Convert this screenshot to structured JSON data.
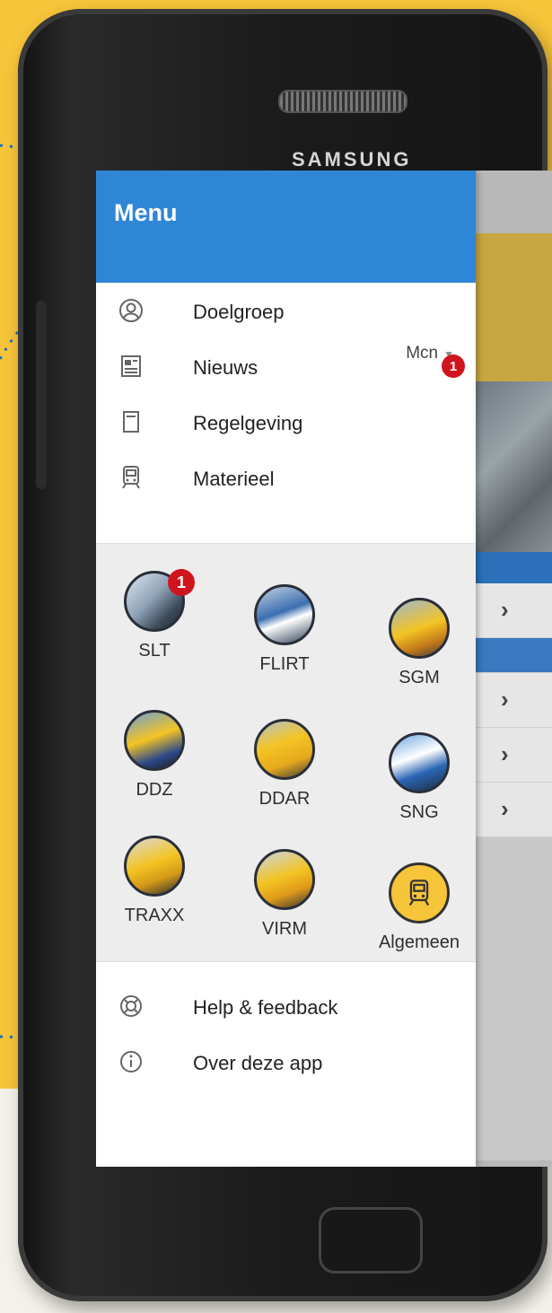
{
  "device": {
    "brand": "SAMSUNG"
  },
  "drawer": {
    "title": "Menu",
    "items": [
      {
        "label": "Doelgroep",
        "icon": "user-circle-icon"
      },
      {
        "label": "Nieuws",
        "icon": "newspaper-icon"
      },
      {
        "label": "Regelgeving",
        "icon": "document-icon"
      },
      {
        "label": "Materieel",
        "icon": "train-icon"
      }
    ],
    "selector": {
      "value": "Mcn"
    },
    "news_badge": "1",
    "trains": [
      {
        "label": "SLT",
        "badge": "1"
      },
      {
        "label": "FLIRT"
      },
      {
        "label": "SGM"
      },
      {
        "label": "DDZ"
      },
      {
        "label": "DDAR"
      },
      {
        "label": "SNG"
      },
      {
        "label": "TRAXX"
      },
      {
        "label": "VIRM"
      },
      {
        "label": "Algemeen",
        "icon": "train-icon"
      }
    ],
    "footer_items": [
      {
        "label": "Help & feedback",
        "icon": "lifebuoy-icon"
      },
      {
        "label": "Over deze app",
        "icon": "info-icon"
      }
    ]
  },
  "colors": {
    "header_blue": "#2f86d6",
    "background_yellow": "#f7c53a",
    "badge_red": "#d0141e"
  }
}
